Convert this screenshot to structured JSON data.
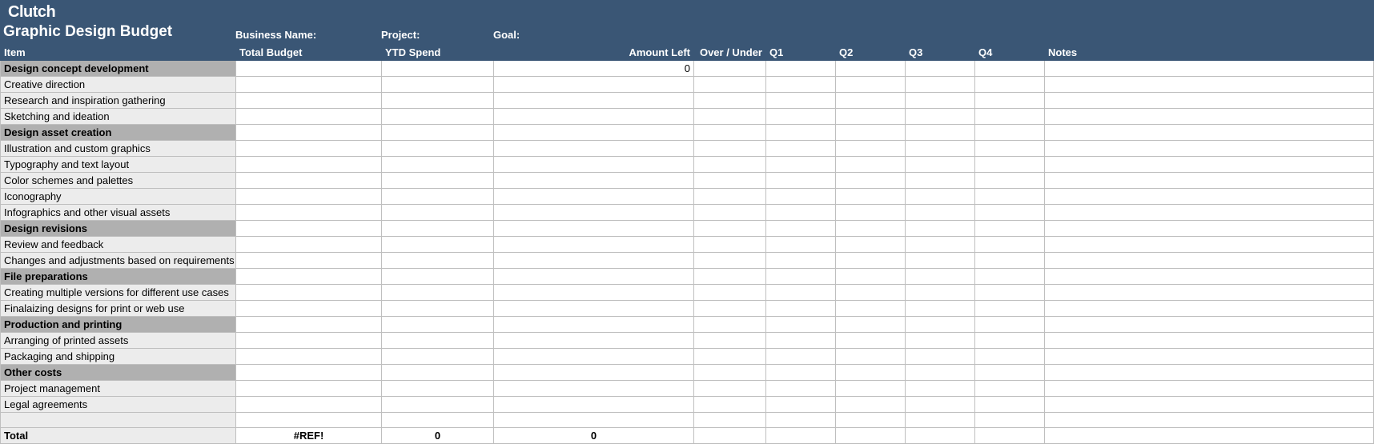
{
  "brand": "Clutch",
  "title": "Graphic Design Budget",
  "metaLabels": {
    "business": "Business Name:",
    "project": "Project:",
    "goal": "Goal:"
  },
  "columns": [
    "Item",
    "Total Budget",
    "YTD Spend",
    "Amount Left",
    "Over / Under",
    "Q1",
    "Q2",
    "Q3",
    "Q4",
    "Notes"
  ],
  "rows": [
    {
      "type": "section",
      "item": "Design concept development",
      "cells": [
        "",
        "",
        "0",
        "",
        "",
        "",
        "",
        "",
        ""
      ]
    },
    {
      "type": "item",
      "item": "Creative direction",
      "cells": [
        "",
        "",
        "",
        "",
        "",
        "",
        "",
        "",
        ""
      ]
    },
    {
      "type": "item",
      "item": "Research and inspiration gathering",
      "cells": [
        "",
        "",
        "",
        "",
        "",
        "",
        "",
        "",
        ""
      ]
    },
    {
      "type": "item",
      "item": "Sketching and ideation",
      "cells": [
        "",
        "",
        "",
        "",
        "",
        "",
        "",
        "",
        ""
      ]
    },
    {
      "type": "section",
      "item": "Design asset creation",
      "cells": [
        "",
        "",
        "",
        "",
        "",
        "",
        "",
        "",
        ""
      ]
    },
    {
      "type": "item",
      "item": "Illustration and custom graphics",
      "cells": [
        "",
        "",
        "",
        "",
        "",
        "",
        "",
        "",
        ""
      ]
    },
    {
      "type": "item",
      "item": "Typography and text layout",
      "cells": [
        "",
        "",
        "",
        "",
        "",
        "",
        "",
        "",
        ""
      ]
    },
    {
      "type": "item",
      "item": "Color schemes and palettes",
      "cells": [
        "",
        "",
        "",
        "",
        "",
        "",
        "",
        "",
        ""
      ]
    },
    {
      "type": "item",
      "item": "Iconography",
      "cells": [
        "",
        "",
        "",
        "",
        "",
        "",
        "",
        "",
        ""
      ]
    },
    {
      "type": "item",
      "item": "Infographics and other visual assets",
      "cells": [
        "",
        "",
        "",
        "",
        "",
        "",
        "",
        "",
        ""
      ]
    },
    {
      "type": "section",
      "item": "Design revisions",
      "cells": [
        "",
        "",
        "",
        "",
        "",
        "",
        "",
        "",
        ""
      ]
    },
    {
      "type": "item",
      "item": "Review and feedback",
      "cells": [
        "",
        "",
        "",
        "",
        "",
        "",
        "",
        "",
        ""
      ]
    },
    {
      "type": "item",
      "item": "Changes and adjustments based on requirements",
      "cells": [
        "",
        "",
        "",
        "",
        "",
        "",
        "",
        "",
        ""
      ]
    },
    {
      "type": "section",
      "item": "File preparations",
      "cells": [
        "",
        "",
        "",
        "",
        "",
        "",
        "",
        "",
        ""
      ]
    },
    {
      "type": "item",
      "item": "Creating multiple versions for different use cases",
      "cells": [
        "",
        "",
        "",
        "",
        "",
        "",
        "",
        "",
        ""
      ]
    },
    {
      "type": "item",
      "item": "Finalaizing designs for print or web use",
      "cells": [
        "",
        "",
        "",
        "",
        "",
        "",
        "",
        "",
        ""
      ]
    },
    {
      "type": "section",
      "item": "Production and printing",
      "cells": [
        "",
        "",
        "",
        "",
        "",
        "",
        "",
        "",
        ""
      ]
    },
    {
      "type": "item",
      "item": "Arranging of printed assets",
      "cells": [
        "",
        "",
        "",
        "",
        "",
        "",
        "",
        "",
        ""
      ]
    },
    {
      "type": "item",
      "item": "Packaging and shipping",
      "cells": [
        "",
        "",
        "",
        "",
        "",
        "",
        "",
        "",
        ""
      ]
    },
    {
      "type": "section",
      "item": "Other costs",
      "cells": [
        "",
        "",
        "",
        "",
        "",
        "",
        "",
        "",
        ""
      ]
    },
    {
      "type": "item",
      "item": "Project management",
      "cells": [
        "",
        "",
        "",
        "",
        "",
        "",
        "",
        "",
        ""
      ]
    },
    {
      "type": "item",
      "item": "Legal agreements",
      "cells": [
        "",
        "",
        "",
        "",
        "",
        "",
        "",
        "",
        ""
      ]
    },
    {
      "type": "blank",
      "item": "",
      "cells": [
        "",
        "",
        "",
        "",
        "",
        "",
        "",
        "",
        ""
      ]
    },
    {
      "type": "total",
      "item": "Total",
      "cells": [
        "#REF!",
        "0",
        "0",
        "",
        "",
        "",
        "",
        "",
        ""
      ]
    }
  ],
  "rightAlignCols": [
    2
  ],
  "centerishTotals": [
    0,
    1,
    2
  ]
}
